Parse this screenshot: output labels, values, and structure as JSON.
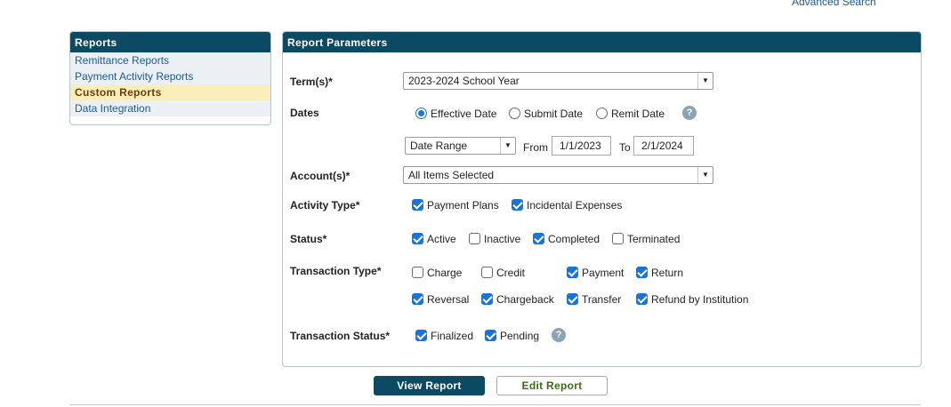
{
  "header": {
    "advanced_search": "Advanced Search"
  },
  "sidebar": {
    "title": "Reports",
    "items": [
      {
        "label": "Remittance Reports",
        "active": false
      },
      {
        "label": "Payment Activity Reports",
        "active": false
      },
      {
        "label": "Custom Reports",
        "active": true
      },
      {
        "label": "Data Integration",
        "active": false
      }
    ]
  },
  "panel": {
    "title": "Report Parameters",
    "terms": {
      "label": "Term(s)*",
      "value": "2023-2024 School Year"
    },
    "dates": {
      "label": "Dates",
      "options": [
        {
          "label": "Effective Date",
          "selected": true
        },
        {
          "label": "Submit Date",
          "selected": false
        },
        {
          "label": "Remit Date",
          "selected": false
        }
      ],
      "range_select": "Date Range",
      "from_label": "From",
      "from_value": "1/1/2023",
      "to_label": "To",
      "to_value": "2/1/2024"
    },
    "accounts": {
      "label": "Account(s)*",
      "value": "All Items Selected"
    },
    "activity_type": {
      "label": "Activity Type*",
      "options": [
        {
          "label": "Payment Plans",
          "checked": true
        },
        {
          "label": "Incidental Expenses",
          "checked": true
        }
      ]
    },
    "status": {
      "label": "Status*",
      "options": [
        {
          "label": "Active",
          "checked": true
        },
        {
          "label": "Inactive",
          "checked": false
        },
        {
          "label": "Completed",
          "checked": true
        },
        {
          "label": "Terminated",
          "checked": false
        }
      ]
    },
    "transaction_type": {
      "label": "Transaction Type*",
      "options": [
        {
          "label": "Charge",
          "checked": false
        },
        {
          "label": "Credit",
          "checked": false
        },
        {
          "label": "Payment",
          "checked": true
        },
        {
          "label": "Return",
          "checked": true
        },
        {
          "label": "Reversal",
          "checked": true
        },
        {
          "label": "Chargeback",
          "checked": true
        },
        {
          "label": "Transfer",
          "checked": true
        },
        {
          "label": "Refund by Institution",
          "checked": true
        }
      ]
    },
    "transaction_status": {
      "label": "Transaction Status*",
      "options": [
        {
          "label": "Finalized",
          "checked": true
        },
        {
          "label": "Pending",
          "checked": true
        }
      ]
    },
    "help_glyph": "?"
  },
  "actions": {
    "view_report": "View Report",
    "edit_report": "Edit Report"
  },
  "colors": {
    "accent": "#0c4a63",
    "checkbox": "#1a73d9",
    "active_item_bg": "#fbeebb",
    "link": "#1c5a9a"
  }
}
